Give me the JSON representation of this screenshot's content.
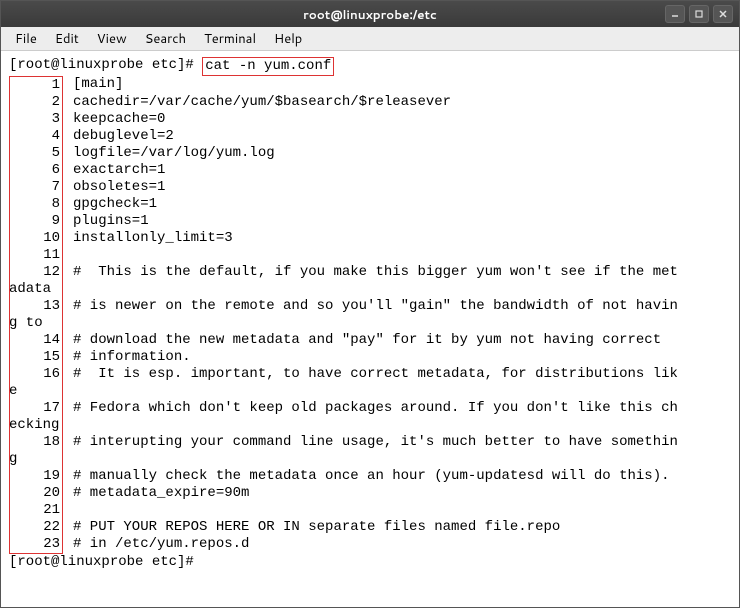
{
  "titlebar": {
    "title": "root@linuxprobe:/etc"
  },
  "menubar": {
    "items": [
      "File",
      "Edit",
      "View",
      "Search",
      "Terminal",
      "Help"
    ]
  },
  "terminal": {
    "prompt": "[root@linuxprobe etc]# ",
    "command": "cat -n yum.conf",
    "final_prompt": "[root@linuxprobe etc]#",
    "lines": [
      {
        "n": "1",
        "t": "[main]"
      },
      {
        "n": "2",
        "t": "cachedir=/var/cache/yum/$basearch/$releasever"
      },
      {
        "n": "3",
        "t": "keepcache=0"
      },
      {
        "n": "4",
        "t": "debuglevel=2"
      },
      {
        "n": "5",
        "t": "logfile=/var/log/yum.log"
      },
      {
        "n": "6",
        "t": "exactarch=1"
      },
      {
        "n": "7",
        "t": "obsoletes=1"
      },
      {
        "n": "8",
        "t": "gpgcheck=1"
      },
      {
        "n": "9",
        "t": "plugins=1"
      },
      {
        "n": "10",
        "t": "installonly_limit=3"
      },
      {
        "n": "11",
        "t": ""
      },
      {
        "n": "12",
        "t": "#  This is the default, if you make this bigger yum won't see if the met",
        "wrap": "adata"
      },
      {
        "n": "13",
        "t": "# is newer on the remote and so you'll \"gain\" the bandwidth of not havin",
        "wrap": "g to"
      },
      {
        "n": "14",
        "t": "# download the new metadata and \"pay\" for it by yum not having correct"
      },
      {
        "n": "15",
        "t": "# information."
      },
      {
        "n": "16",
        "t": "#  It is esp. important, to have correct metadata, for distributions lik",
        "wrap": "e"
      },
      {
        "n": "17",
        "t": "# Fedora which don't keep old packages around. If you don't like this ch",
        "wrap": "ecking"
      },
      {
        "n": "18",
        "t": "# interupting your command line usage, it's much better to have somethin",
        "wrap": "g"
      },
      {
        "n": "19",
        "t": "# manually check the metadata once an hour (yum-updatesd will do this)."
      },
      {
        "n": "20",
        "t": "# metadata_expire=90m"
      },
      {
        "n": "21",
        "t": ""
      },
      {
        "n": "22",
        "t": "# PUT YOUR REPOS HERE OR IN separate files named file.repo"
      },
      {
        "n": "23",
        "t": "# in /etc/yum.repos.d"
      }
    ]
  }
}
